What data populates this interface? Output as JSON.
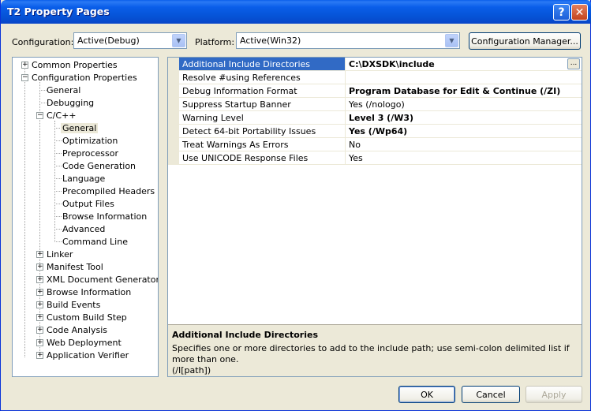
{
  "window": {
    "title": "T2 Property Pages",
    "help": "?",
    "close": "✕"
  },
  "config": {
    "configuration_label": "Configuration:",
    "configuration_value": "Active(Debug)",
    "platform_label": "Platform:",
    "platform_value": "Active(Win32)",
    "manager_button": "Configuration Manager..."
  },
  "tree": {
    "common": "Common Properties",
    "config_props": "Configuration Properties",
    "general": "General",
    "debugging": "Debugging",
    "cpp": "C/C++",
    "cpp_children": [
      "General",
      "Optimization",
      "Preprocessor",
      "Code Generation",
      "Language",
      "Precompiled Headers",
      "Output Files",
      "Browse Information",
      "Advanced",
      "Command Line"
    ],
    "others": [
      "Linker",
      "Manifest Tool",
      "XML Document Generator",
      "Browse Information",
      "Build Events",
      "Custom Build Step",
      "Code Analysis",
      "Web Deployment",
      "Application Verifier"
    ]
  },
  "properties": [
    {
      "name": "Additional Include Directories",
      "value": "C:\\DXSDK\\include",
      "bold": true
    },
    {
      "name": "Resolve #using References",
      "value": "",
      "bold": false
    },
    {
      "name": "Debug Information Format",
      "value": "Program Database for Edit & Continue (/ZI)",
      "bold": true
    },
    {
      "name": "Suppress Startup Banner",
      "value": "Yes (/nologo)",
      "bold": false
    },
    {
      "name": "Warning Level",
      "value": "Level 3 (/W3)",
      "bold": true
    },
    {
      "name": "Detect 64-bit Portability Issues",
      "value": "Yes (/Wp64)",
      "bold": true
    },
    {
      "name": "Treat Warnings As Errors",
      "value": "No",
      "bold": false
    },
    {
      "name": "Use UNICODE Response Files",
      "value": "Yes",
      "bold": false
    }
  ],
  "ellipsis": "...",
  "description": {
    "title": "Additional Include Directories",
    "body": "Specifies one or more directories to add to the include path; use semi-colon delimited list if more than one.",
    "switch": "(/I[path])"
  },
  "buttons": {
    "ok": "OK",
    "cancel": "Cancel",
    "apply": "Apply"
  }
}
